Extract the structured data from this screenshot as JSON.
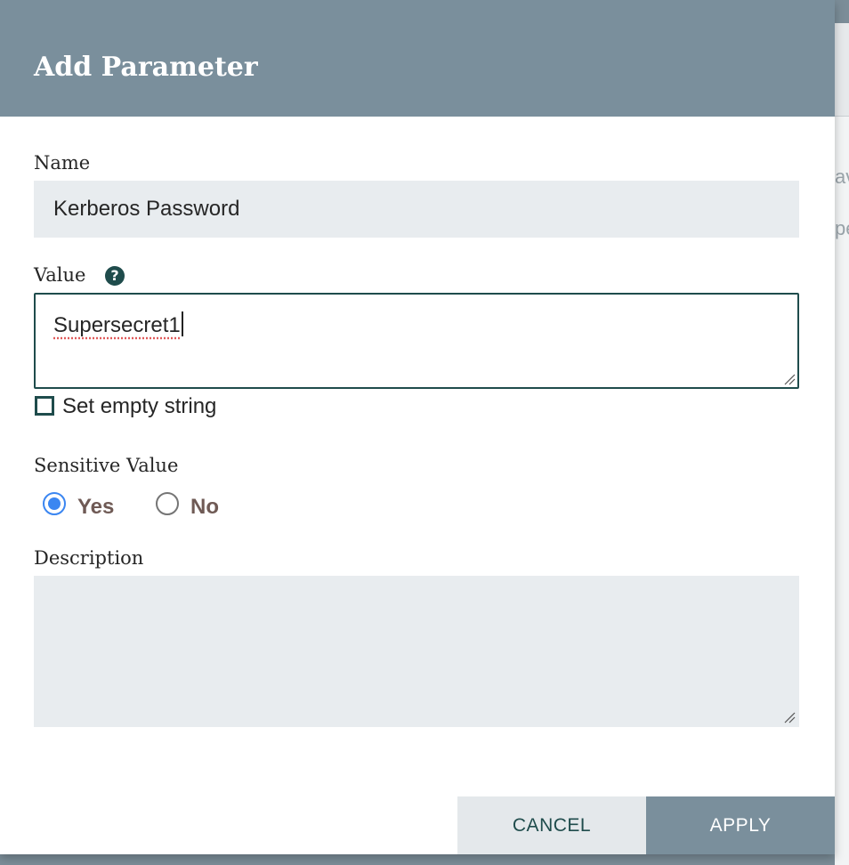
{
  "dialog": {
    "title": "Add Parameter"
  },
  "form": {
    "name": {
      "label": "Name",
      "value": "Kerberos Password"
    },
    "value": {
      "label": "Value",
      "help_icon": "question-circle-icon",
      "text": "Supersecret1"
    },
    "set_empty_string": {
      "label": "Set empty string",
      "checked": false
    },
    "sensitive": {
      "label": "Sensitive Value",
      "yes_label": "Yes",
      "no_label": "No",
      "selected": "Yes"
    },
    "description": {
      "label": "Description",
      "value": ""
    }
  },
  "buttons": {
    "cancel": "CANCEL",
    "apply": "APPLY"
  },
  "background": {
    "fragment_1": "av",
    "fragment_2": "pe"
  },
  "colors": {
    "header": "#7a8f9c",
    "accent": "#1f4c4c",
    "radio_selected": "#3b86f1",
    "field_background": "#e8ecef"
  }
}
